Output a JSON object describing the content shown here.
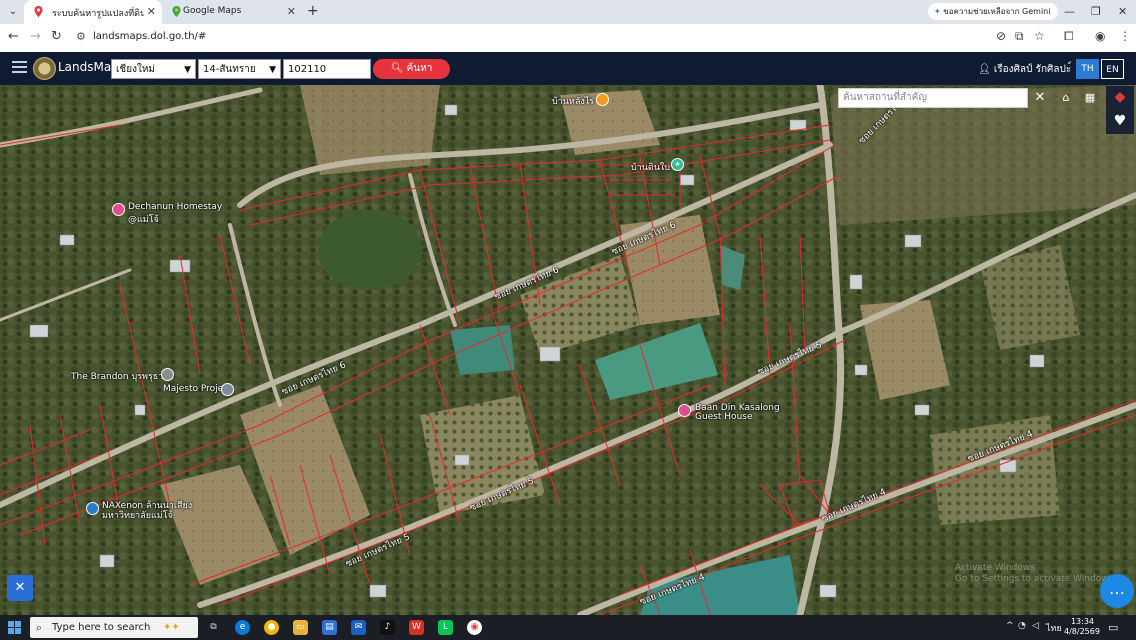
{
  "browser": {
    "tabs": [
      {
        "title": "ระบบค้นหารูปแปลงที่ดิน (LandsMa",
        "active": true
      },
      {
        "title": "Google Maps",
        "active": false
      }
    ],
    "gemini_label": "ขอความช่วยเหลือจาก Gemini",
    "url": "landsmaps.dol.go.th/#"
  },
  "site": {
    "brand": "LandsMaps",
    "province": "เชียงใหม่",
    "district": "14-สันทราย",
    "postcode": "102110",
    "search_label": "ค้นหา",
    "user_name": "เรืองศิลป์ รักศิลปะ์",
    "lang_th": "TH",
    "lang_en": "EN"
  },
  "map": {
    "search_placeholder": "ค้นหาสถานที่สำคัญ",
    "places": [
      {
        "name": "บ้านหลังไร่"
      },
      {
        "name": "บ้านดินใบ"
      },
      {
        "name": "Dechanun Homestay",
        "sub": "@แม่โจ้"
      },
      {
        "name": "The Brandon บุรพรุธา"
      },
      {
        "name": "Majesto Project"
      },
      {
        "name": "Baan Din Kasalong",
        "sub": "Guest House"
      },
      {
        "name": "NAXenon ล้านนาเสียง",
        "sub": "มหาวิทยาลัยแม่โจ้"
      }
    ],
    "roads": [
      "ซอย เกษตรไทย 6",
      "ซอย เกษตรไทย 6",
      "ซอย เกษตรไทย 6",
      "ซอย เกษตรไทย 5",
      "ซอย เกษตรไทย 5",
      "ซอย เกษตรไทย 5",
      "ซอย เกษตรไทย 4",
      "ซอย เกษตรไทย 4",
      "ซอย เกษตรไทย 4",
      "ซอย เกษตรไทย 6"
    ]
  },
  "taskbar": {
    "search_placeholder": "Type here to search",
    "lang": "ไทย",
    "time": "13:34",
    "date": "4/8/2569"
  },
  "colors": {
    "header_bg": "#0f1a33",
    "search_button": "#e7333b",
    "parcel_lines": "#e8282c",
    "lang_active": "#2b7bd3",
    "fab": "#1e88e5"
  }
}
